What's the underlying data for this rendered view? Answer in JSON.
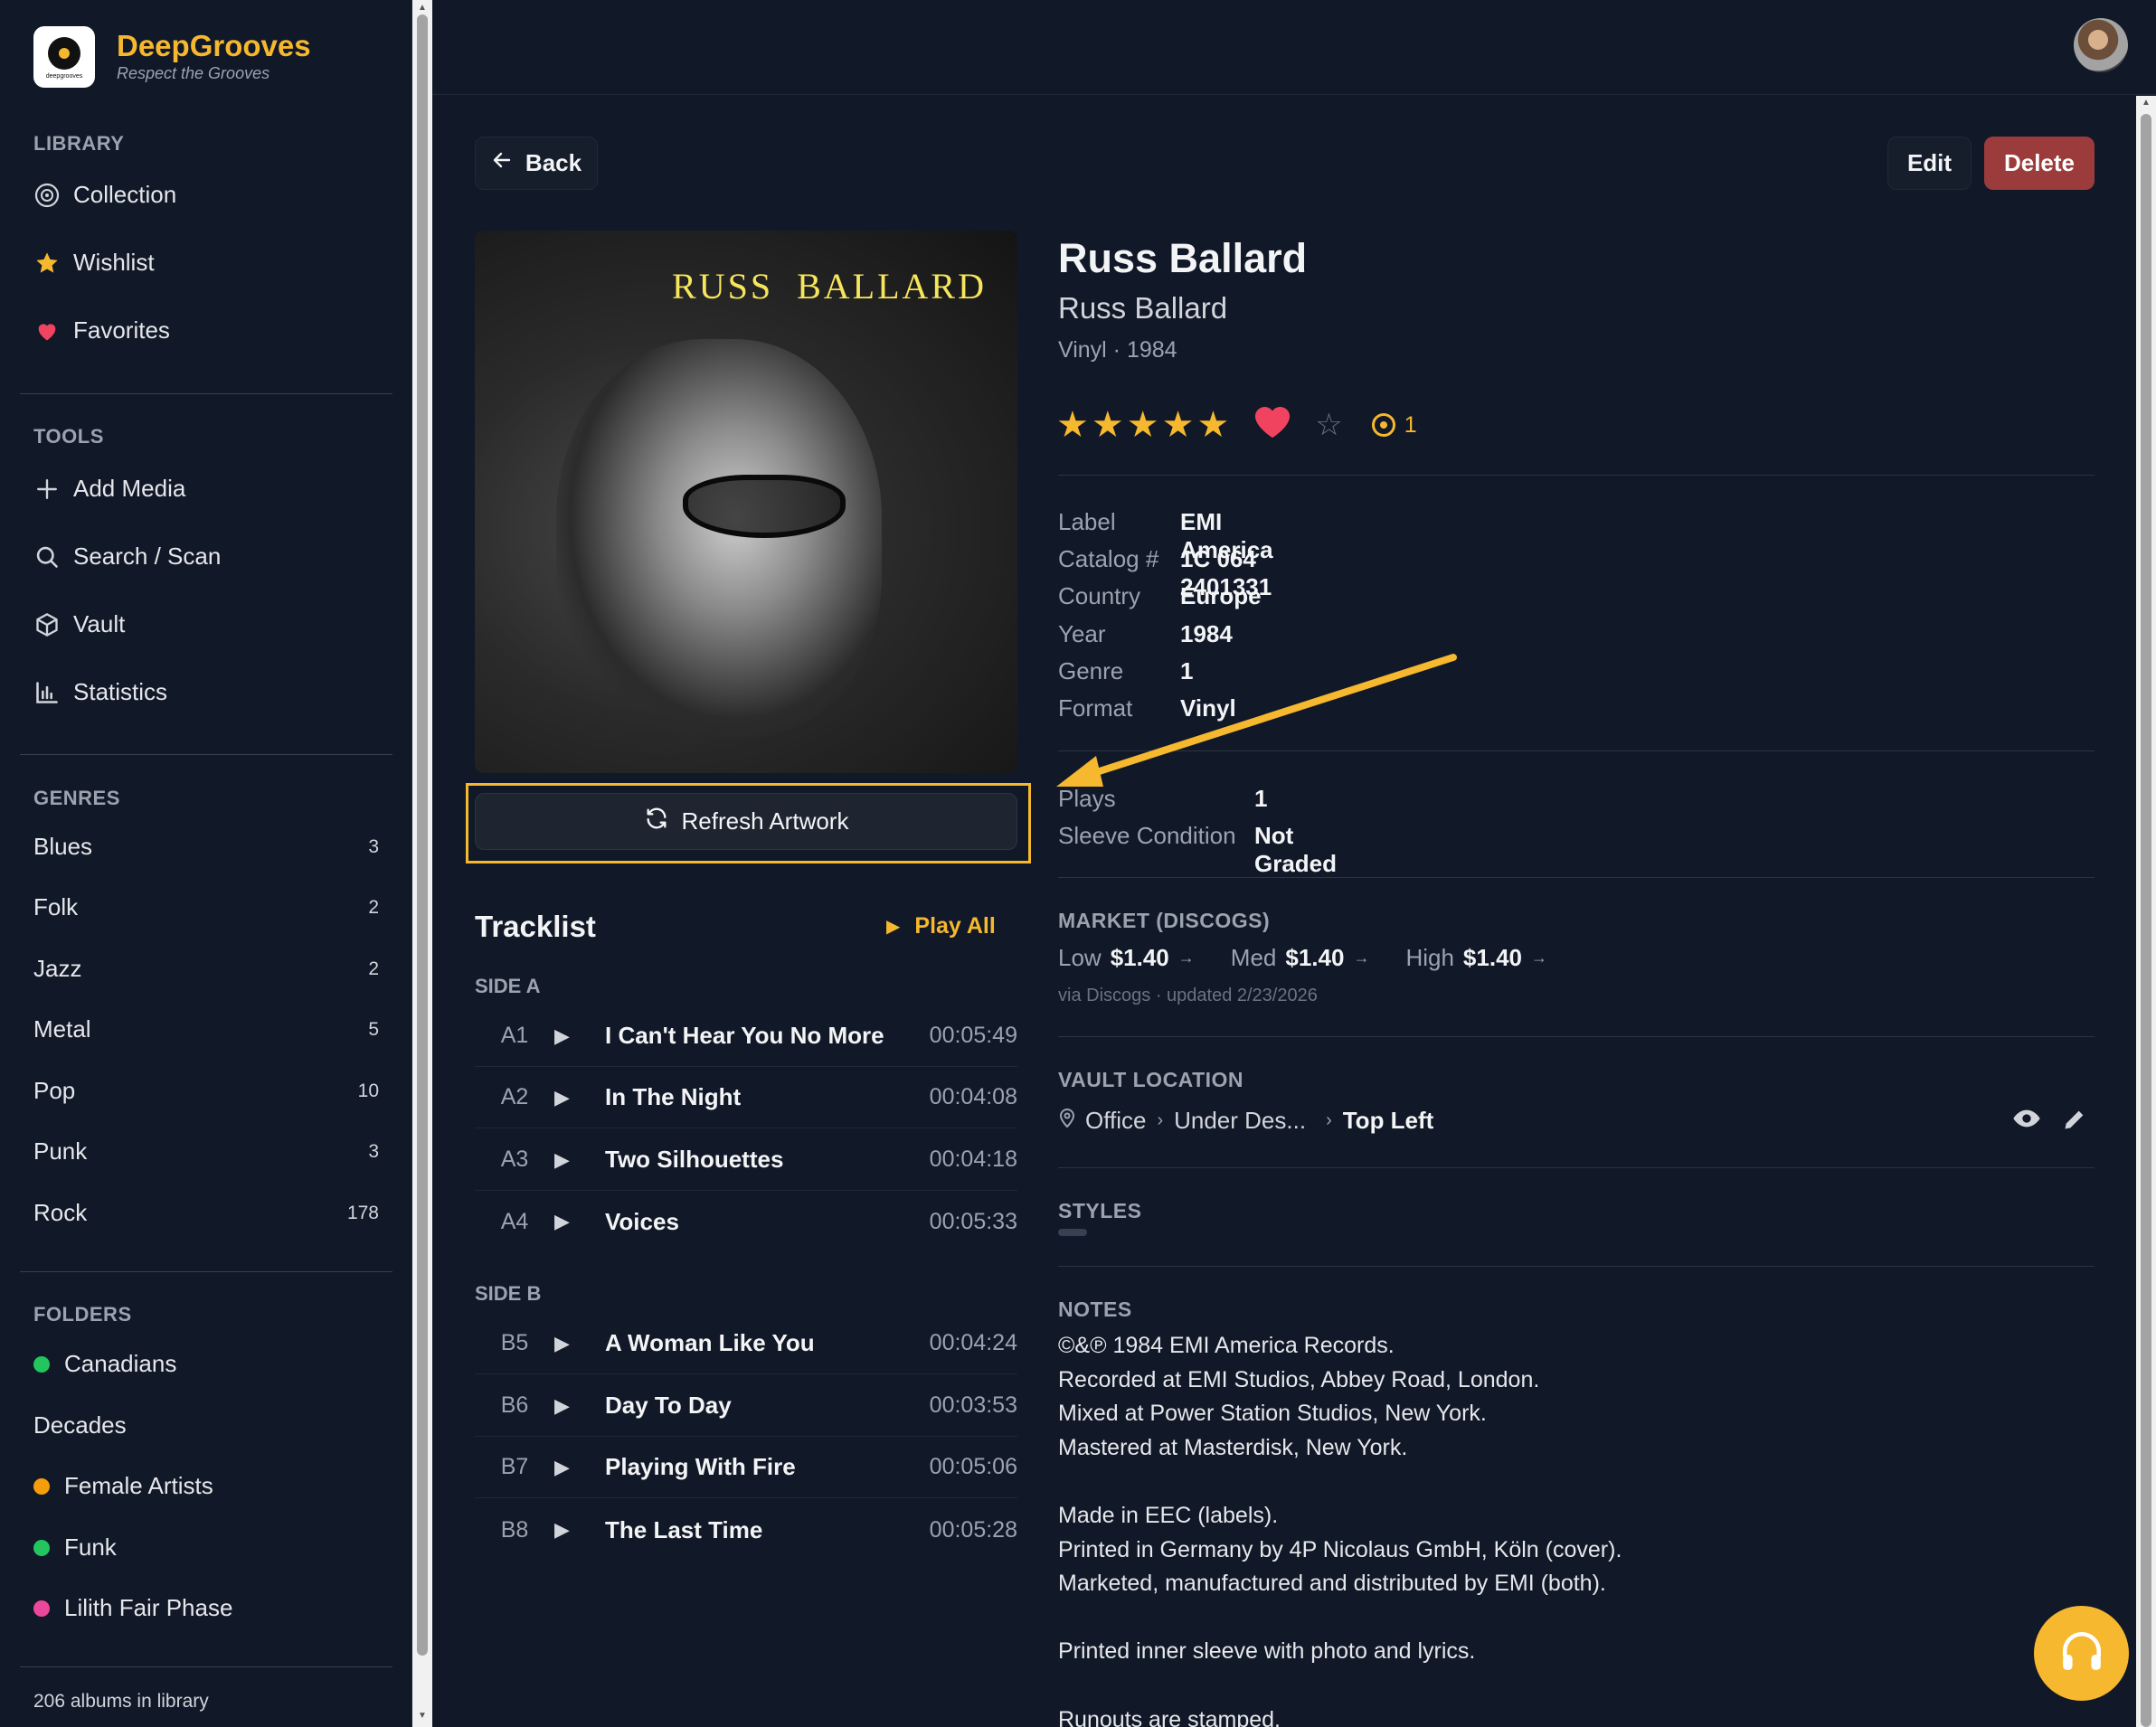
{
  "brand": {
    "name": "DeepGrooves",
    "tagline": "Respect the Grooves",
    "logo_text": "deepgrooves"
  },
  "sidebar": {
    "library_title": "LIBRARY",
    "library_items": [
      {
        "label": "Collection",
        "icon": "vinyl-icon"
      },
      {
        "label": "Wishlist",
        "icon": "star-icon"
      },
      {
        "label": "Favorites",
        "icon": "heart-icon"
      }
    ],
    "tools_title": "TOOLS",
    "tools_items": [
      {
        "label": "Add Media",
        "icon": "plus-icon"
      },
      {
        "label": "Search / Scan",
        "icon": "search-icon"
      },
      {
        "label": "Vault",
        "icon": "box-icon"
      },
      {
        "label": "Statistics",
        "icon": "bar-chart-icon"
      }
    ],
    "genres_title": "GENRES",
    "genres": [
      {
        "name": "Blues",
        "count": "3"
      },
      {
        "name": "Folk",
        "count": "2"
      },
      {
        "name": "Jazz",
        "count": "2"
      },
      {
        "name": "Metal",
        "count": "5"
      },
      {
        "name": "Pop",
        "count": "10"
      },
      {
        "name": "Punk",
        "count": "3"
      },
      {
        "name": "Rock",
        "count": "178"
      }
    ],
    "folders_title": "FOLDERS",
    "folders": [
      {
        "name": "Canadians",
        "color": "#22c55e"
      },
      {
        "name": "Decades",
        "color": ""
      },
      {
        "name": "Female Artists",
        "color": "#f59e0b"
      },
      {
        "name": "Funk",
        "color": "#22c55e"
      },
      {
        "name": "Lilith Fair Phase",
        "color": "#ec4899"
      }
    ],
    "library_count": "206 albums in library"
  },
  "actions": {
    "back": "Back",
    "edit": "Edit",
    "delete": "Delete",
    "refresh_artwork": "Refresh Artwork",
    "play_all": "Play All"
  },
  "album": {
    "artist": "Russ Ballard",
    "title": "Russ Ballard",
    "meta": "Vinyl · 1984",
    "cover_text": "RUSS  BALLARD",
    "rating": 5,
    "favorite": true,
    "plays_badge": "1",
    "details": [
      {
        "key": "Label",
        "value": "EMI America"
      },
      {
        "key": "Catalog #",
        "value": "1C 064 2401331"
      },
      {
        "key": "Country",
        "value": "Europe"
      },
      {
        "key": "Year",
        "value": "1984"
      },
      {
        "key": "Genre",
        "value": "1"
      },
      {
        "key": "Format",
        "value": "Vinyl"
      }
    ],
    "stats": [
      {
        "key": "Plays",
        "value": "1"
      },
      {
        "key": "Sleeve Condition",
        "value": "Not Graded"
      }
    ]
  },
  "tracklist": {
    "title": "Tracklist",
    "sides": [
      {
        "label": "SIDE A",
        "tracks": [
          {
            "pos": "A1",
            "title": "I Can't Hear You No More",
            "duration": "00:05:49"
          },
          {
            "pos": "A2",
            "title": "In The Night",
            "duration": "00:04:08"
          },
          {
            "pos": "A3",
            "title": "Two Silhouettes",
            "duration": "00:04:18"
          },
          {
            "pos": "A4",
            "title": "Voices",
            "duration": "00:05:33"
          }
        ]
      },
      {
        "label": "SIDE B",
        "tracks": [
          {
            "pos": "B5",
            "title": "A Woman Like You",
            "duration": "00:04:24"
          },
          {
            "pos": "B6",
            "title": "Day To Day",
            "duration": "00:03:53"
          },
          {
            "pos": "B7",
            "title": "Playing With Fire",
            "duration": "00:05:06"
          },
          {
            "pos": "B8",
            "title": "The Last Time",
            "duration": "00:05:28"
          }
        ]
      }
    ]
  },
  "market": {
    "title": "MARKET (DISCOGS)",
    "low_label": "Low",
    "low": "$1.40",
    "med_label": "Med",
    "med": "$1.40",
    "high_label": "High",
    "high": "$1.40",
    "sub": "via Discogs · updated 2/23/2026"
  },
  "vault": {
    "title": "VAULT LOCATION",
    "path": [
      "Office",
      "Under Des...",
      "Top Left"
    ]
  },
  "styles": {
    "title": "STYLES"
  },
  "notes": {
    "title": "NOTES",
    "lines": [
      "©&℗ 1984 EMI America Records.",
      "Recorded at EMI Studios, Abbey Road, London.",
      "Mixed at Power Station Studios, New York.",
      "Mastered at Masterdisk, New York.",
      "",
      "Made in EEC (labels).",
      "Printed in Germany by 4P Nicolaus GmbH, Köln (cover).",
      "Marketed, manufactured and distributed by EMI (both).",
      "",
      "Printed inner sleeve with photo and lyrics.",
      "",
      "Runouts are stamped."
    ]
  },
  "colors": {
    "accent": "#f5b82e",
    "delete": "#9b3b3b",
    "heart": "#f0435f",
    "background": "#111827"
  }
}
